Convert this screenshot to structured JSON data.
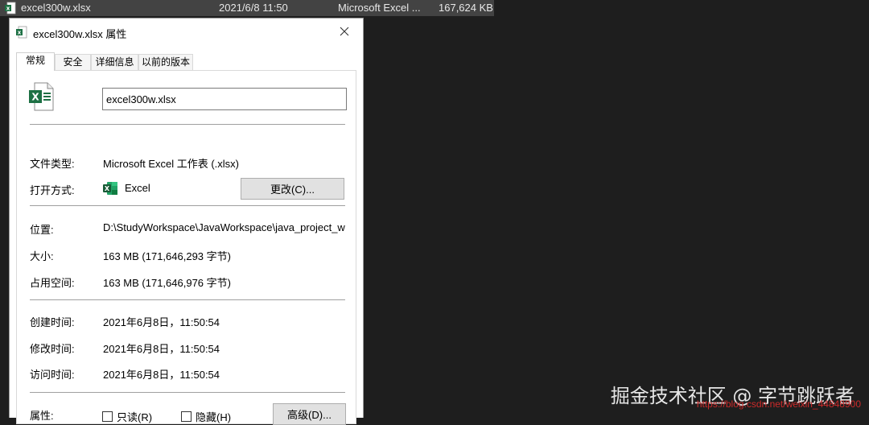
{
  "file_row": {
    "name": "excel300w.xlsx",
    "date": "2021/6/8 11:50",
    "type": "Microsoft Excel ...",
    "size": "167,624 KB"
  },
  "dialog": {
    "title": "excel300w.xlsx 属性",
    "tabs": [
      "常规",
      "安全",
      "详细信息",
      "以前的版本"
    ],
    "filename_value": "excel300w.xlsx",
    "file_type_label": "文件类型:",
    "file_type_value": "Microsoft Excel 工作表 (.xlsx)",
    "opens_with_label": "打开方式:",
    "opens_with_value": "Excel",
    "change_button": "更改(C)...",
    "location_label": "位置:",
    "location_value": "D:\\StudyWorkspace\\JavaWorkspace\\java_project_w",
    "size_label": "大小:",
    "size_value": "163 MB (171,646,293 字节)",
    "size_on_disk_label": "占用空间:",
    "size_on_disk_value": "163 MB (171,646,976 字节)",
    "created_label": "创建时间:",
    "created_value": "2021年6月8日，11:50:54",
    "modified_label": "修改时间:",
    "modified_value": "2021年6月8日，11:50:54",
    "accessed_label": "访问时间:",
    "accessed_value": "2021年6月8日，11:50:54",
    "attributes_label": "属性:",
    "readonly_label": "只读(R)",
    "hidden_label": "隐藏(H)",
    "advanced_button": "高级(D)..."
  },
  "watermark": {
    "juejin": "掘金技术社区 @ 字节跳跃者",
    "csdn": "https://blog.csdn.net/weixin_44848900"
  },
  "icons": {
    "file_row_icon": "excel-file-icon",
    "title_icon": "excel-file-icon",
    "large_icon": "excel-document-icon",
    "opens_with_icon": "excel-app-icon",
    "close": "close-icon"
  },
  "colors": {
    "excel_green": "#1d7044",
    "background": "#1e1e1e",
    "file_row_bg": "#434343"
  }
}
